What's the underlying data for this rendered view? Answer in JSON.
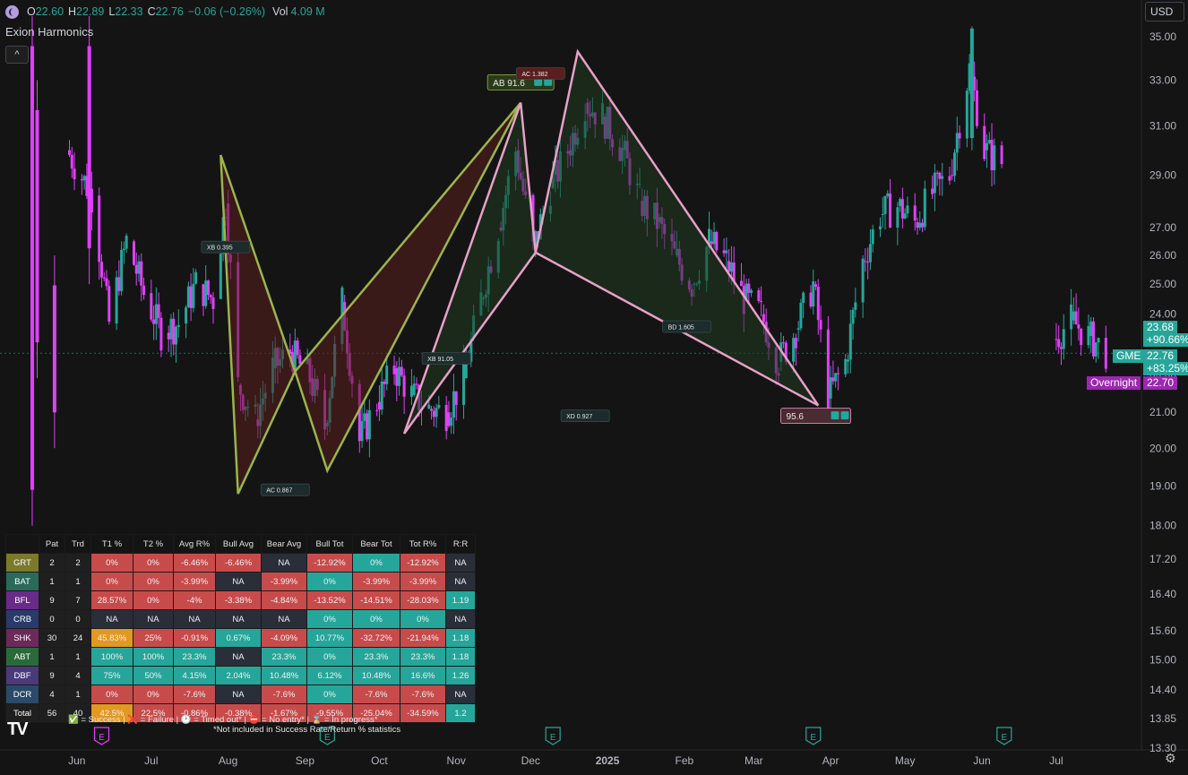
{
  "header": {
    "open_label": "O",
    "open": "22.60",
    "high_label": "H",
    "high": "22.89",
    "low_label": "L",
    "low": "22.33",
    "close_label": "C",
    "close": "22.76",
    "change": "−0.06 (−0.26%)",
    "vol_label": "Vol",
    "vol": "4.09 M"
  },
  "indicator_title": "Exion Harmonics",
  "collapse_glyph": "^",
  "currency": "USD",
  "price_axis": [
    "35.00",
    "33.00",
    "31.00",
    "29.00",
    "27.00",
    "26.00",
    "25.00",
    "24.00",
    "22.00",
    "21.00",
    "20.00",
    "19.00",
    "18.00",
    "17.20",
    "16.40",
    "15.60",
    "15.00",
    "14.40",
    "13.85",
    "13.30"
  ],
  "tags": {
    "t1_price": "23.68",
    "t1_pct": "+90.66%",
    "gme_label": "GME",
    "gme_price": "22.76",
    "gme_pct": "+83.25%",
    "overnight_label": "Overnight",
    "overnight_price": "22.70"
  },
  "colors": {
    "up": "#26a69a",
    "down": "#e040fb",
    "bg": "#141414",
    "pattern_green": "#9bb54a",
    "pattern_pink": "#e8a0c8",
    "fill_red": "#5a1e1e",
    "fill_green": "#1f3a1f",
    "cell_red": "#c84b4b",
    "cell_teal": "#26a69a",
    "cell_orange": "#e39820",
    "cell_gray": "#2a2e39"
  },
  "chart_data": {
    "type": "candlestick",
    "title": "",
    "symbol": "GME",
    "x_ticks": [
      "Jun",
      "Jul",
      "Aug",
      "Sep",
      "Oct",
      "Nov",
      "Dec",
      "2025",
      "Feb",
      "Mar",
      "Apr",
      "May",
      "Jun",
      "Jul"
    ],
    "ylim": [
      13.3,
      36.0
    ],
    "y_scale": "log",
    "series_close_approx": [
      {
        "date": "2024-05-28",
        "close": 30.0
      },
      {
        "date": "2024-06-07",
        "close": 28.2
      },
      {
        "date": "2024-06-14",
        "close": 23.7
      },
      {
        "date": "2024-06-21",
        "close": 26.5
      },
      {
        "date": "2024-06-28",
        "close": 24.7
      },
      {
        "date": "2024-07-05",
        "close": 23.4
      },
      {
        "date": "2024-07-12",
        "close": 23.7
      },
      {
        "date": "2024-07-19",
        "close": 25.0
      },
      {
        "date": "2024-07-26",
        "close": 24.5
      },
      {
        "date": "2024-07-31",
        "close": 27.9
      },
      {
        "date": "2024-08-05",
        "close": 21.8
      },
      {
        "date": "2024-08-12",
        "close": 20.8
      },
      {
        "date": "2024-08-19",
        "close": 22.3
      },
      {
        "date": "2024-08-26",
        "close": 22.8
      },
      {
        "date": "2024-09-03",
        "close": 22.0
      },
      {
        "date": "2024-09-09",
        "close": 20.6
      },
      {
        "date": "2024-09-16",
        "close": 24.4
      },
      {
        "date": "2024-09-23",
        "close": 20.2
      },
      {
        "date": "2024-09-30",
        "close": 21.3
      },
      {
        "date": "2024-10-07",
        "close": 22.3
      },
      {
        "date": "2024-10-14",
        "close": 21.5
      },
      {
        "date": "2024-10-21",
        "close": 21.1
      },
      {
        "date": "2024-10-28",
        "close": 21.0
      },
      {
        "date": "2024-11-04",
        "close": 22.0
      },
      {
        "date": "2024-11-11",
        "close": 24.5
      },
      {
        "date": "2024-11-18",
        "close": 27.0
      },
      {
        "date": "2024-11-25",
        "close": 30.0
      },
      {
        "date": "2024-12-02",
        "close": 26.2
      },
      {
        "date": "2024-12-09",
        "close": 28.5
      },
      {
        "date": "2024-12-16",
        "close": 30.0
      },
      {
        "date": "2024-12-23",
        "close": 32.0
      },
      {
        "date": "2024-12-30",
        "close": 31.4
      },
      {
        "date": "2025-01-07",
        "close": 30.0
      },
      {
        "date": "2025-01-14",
        "close": 28.0
      },
      {
        "date": "2025-01-21",
        "close": 27.2
      },
      {
        "date": "2025-01-28",
        "close": 26.0
      },
      {
        "date": "2025-02-04",
        "close": 25.0
      },
      {
        "date": "2025-02-11",
        "close": 26.5
      },
      {
        "date": "2025-02-18",
        "close": 25.8
      },
      {
        "date": "2025-02-25",
        "close": 24.5
      },
      {
        "date": "2025-03-04",
        "close": 24.0
      },
      {
        "date": "2025-03-11",
        "close": 22.5
      },
      {
        "date": "2025-03-18",
        "close": 23.5
      },
      {
        "date": "2025-03-25",
        "close": 25.0
      },
      {
        "date": "2025-03-31",
        "close": 21.4
      },
      {
        "date": "2025-04-07",
        "close": 22.5
      },
      {
        "date": "2025-04-14",
        "close": 25.8
      },
      {
        "date": "2025-04-21",
        "close": 27.5
      },
      {
        "date": "2025-04-28",
        "close": 27.8
      },
      {
        "date": "2025-05-05",
        "close": 27.2
      },
      {
        "date": "2025-05-12",
        "close": 28.3
      },
      {
        "date": "2025-05-19",
        "close": 29.0
      },
      {
        "date": "2025-05-27",
        "close": 33.5
      },
      {
        "date": "2025-06-02",
        "close": 30.0
      },
      {
        "date": "2025-06-09",
        "close": 29.5
      },
      {
        "date": "2025-06-16",
        "close": null
      },
      {
        "date": "2025-06-30",
        "close": 23.2
      },
      {
        "date": "2025-07-07",
        "close": 23.8
      },
      {
        "date": "2025-07-14",
        "close": 23.3
      },
      {
        "date": "2025-07-21",
        "close": 22.8
      }
    ],
    "patterns": [
      {
        "name": "pattern-1",
        "color": "pattern_green",
        "fill": "fill_red",
        "points": [
          [
            "2024-07-29",
            29.8
          ],
          [
            "2024-08-05",
            18.8
          ],
          [
            "2024-08-28",
            22.2
          ],
          [
            "2024-09-10",
            19.4
          ],
          [
            "2024-11-27",
            32.0
          ]
        ]
      },
      {
        "name": "pattern-2",
        "color": "pattern_pink",
        "fill": "fill_green",
        "points": [
          [
            "2024-10-11",
            20.4
          ],
          [
            "2024-11-27",
            32.0
          ],
          [
            "2024-12-03",
            26.1
          ],
          [
            "2024-12-20",
            34.3
          ],
          [
            "2025-03-27",
            21.2
          ]
        ]
      }
    ],
    "annotations": [
      {
        "label": "AB 91.6",
        "date": "2024-11-27",
        "price": 32.9,
        "style": "green-badge"
      },
      {
        "label": "AC 1.382",
        "date": "2024-12-05",
        "price": 33.3,
        "style": "red-badge"
      },
      {
        "label": "XB 0.395",
        "date": "2024-07-31",
        "price": 26.3,
        "style": "dark"
      },
      {
        "label": "AC 0.867",
        "date": "2024-08-24",
        "price": 18.9,
        "style": "dark"
      },
      {
        "label": "XB 91.05",
        "date": "2024-10-28",
        "price": 22.6,
        "style": "dark"
      },
      {
        "label": "BD 1.605",
        "date": "2025-02-02",
        "price": 23.6,
        "style": "dark"
      },
      {
        "label": "XD 0.927",
        "date": "2024-12-23",
        "price": 20.9,
        "style": "dark"
      },
      {
        "label": "95.6",
        "date": "2025-03-26",
        "price": 20.9,
        "style": "result"
      }
    ],
    "earnings_markers": [
      {
        "date": "2024-06-11",
        "label": "E",
        "color": "down"
      },
      {
        "date": "2024-09-10",
        "label": "E",
        "color": "up"
      },
      {
        "date": "2024-12-10",
        "label": "E",
        "color": "up"
      },
      {
        "date": "2025-03-25",
        "label": "E",
        "color": "up"
      },
      {
        "date": "2025-06-10",
        "label": "E",
        "color": "up"
      }
    ]
  },
  "stats_table": {
    "headers": [
      "",
      "Pat",
      "Trd",
      "T1 %",
      "T2 %",
      "Avg R%",
      "Bull Avg",
      "Bear Avg",
      "Bull Tot",
      "Bear Tot",
      "Tot R%",
      "R:R"
    ],
    "rows": [
      {
        "name": "GRT",
        "tag": "#7a7a2a",
        "cells": [
          "2",
          "2",
          "0%",
          "0%",
          "-6.46%",
          "-6.46%",
          "NA",
          "-12.92%",
          "0%",
          "-12.92%",
          "NA"
        ],
        "bg": [
          "num",
          "num",
          "red",
          "red",
          "red",
          "red",
          "gray",
          "red",
          "teal",
          "red",
          "gray"
        ]
      },
      {
        "name": "BAT",
        "tag": "#2a6a5a",
        "cells": [
          "1",
          "1",
          "0%",
          "0%",
          "-3.99%",
          "NA",
          "-3.99%",
          "0%",
          "-3.99%",
          "-3.99%",
          "NA"
        ],
        "bg": [
          "num",
          "num",
          "red",
          "red",
          "red",
          "gray",
          "red",
          "teal",
          "red",
          "red",
          "gray"
        ]
      },
      {
        "name": "BFL",
        "tag": "#6a2a8a",
        "cells": [
          "9",
          "7",
          "28.57%",
          "0%",
          "-4%",
          "-3.38%",
          "-4.84%",
          "-13.52%",
          "-14.51%",
          "-28.03%",
          "1.19"
        ],
        "bg": [
          "num",
          "num",
          "red",
          "red",
          "red",
          "red",
          "red",
          "red",
          "red",
          "red",
          "teal"
        ]
      },
      {
        "name": "CRB",
        "tag": "#2a3a6a",
        "cells": [
          "0",
          "0",
          "NA",
          "NA",
          "NA",
          "NA",
          "NA",
          "0%",
          "0%",
          "0%",
          "NA"
        ],
        "bg": [
          "num",
          "num",
          "gray",
          "gray",
          "gray",
          "gray",
          "gray",
          "teal",
          "teal",
          "teal",
          "gray"
        ]
      },
      {
        "name": "SHK",
        "tag": "#6a2a5a",
        "cells": [
          "30",
          "24",
          "45.83%",
          "25%",
          "-0.91%",
          "0.67%",
          "-4.09%",
          "10.77%",
          "-32.72%",
          "-21.94%",
          "1.18"
        ],
        "bg": [
          "num",
          "num",
          "orange",
          "red",
          "red",
          "teal",
          "red",
          "teal",
          "red",
          "red",
          "teal"
        ]
      },
      {
        "name": "ABT",
        "tag": "#2a6a3a",
        "cells": [
          "1",
          "1",
          "100%",
          "100%",
          "23.3%",
          "NA",
          "23.3%",
          "0%",
          "23.3%",
          "23.3%",
          "1.18"
        ],
        "bg": [
          "num",
          "num",
          "teal",
          "teal",
          "teal",
          "gray",
          "teal",
          "teal",
          "teal",
          "teal",
          "teal"
        ]
      },
      {
        "name": "DBF",
        "tag": "#4a3a7a",
        "cells": [
          "9",
          "4",
          "75%",
          "50%",
          "4.15%",
          "2.04%",
          "10.48%",
          "6.12%",
          "10.48%",
          "16.6%",
          "1.26"
        ],
        "bg": [
          "num",
          "num",
          "teal",
          "teal",
          "teal",
          "teal",
          "teal",
          "teal",
          "teal",
          "teal",
          "teal"
        ]
      },
      {
        "name": "DCR",
        "tag": "#2a4a6a",
        "cells": [
          "4",
          "1",
          "0%",
          "0%",
          "-7.6%",
          "NA",
          "-7.6%",
          "0%",
          "-7.6%",
          "-7.6%",
          "NA"
        ],
        "bg": [
          "num",
          "num",
          "red",
          "red",
          "red",
          "gray",
          "red",
          "teal",
          "red",
          "red",
          "gray"
        ]
      },
      {
        "name": "Total",
        "tag": "#1f1f1f",
        "cells": [
          "56",
          "40",
          "42.5%",
          "22.5%",
          "-0.86%",
          "-0.38%",
          "-1.67%",
          "-9.55%",
          "-25.04%",
          "-34.59%",
          "1.2"
        ],
        "bg": [
          "num",
          "num",
          "orange",
          "red",
          "red",
          "red",
          "red",
          "red",
          "red",
          "red",
          "teal"
        ]
      }
    ],
    "legend_line1": "✅ = Success | ❌ = Failure | 🕐 = Timed out* | ⛔ = No entry* | ⌛ = In progress*",
    "legend_line2": "*Not included in Success Rate/Return % statistics"
  },
  "logo_text": "TV",
  "gear_icon": "gear-icon"
}
